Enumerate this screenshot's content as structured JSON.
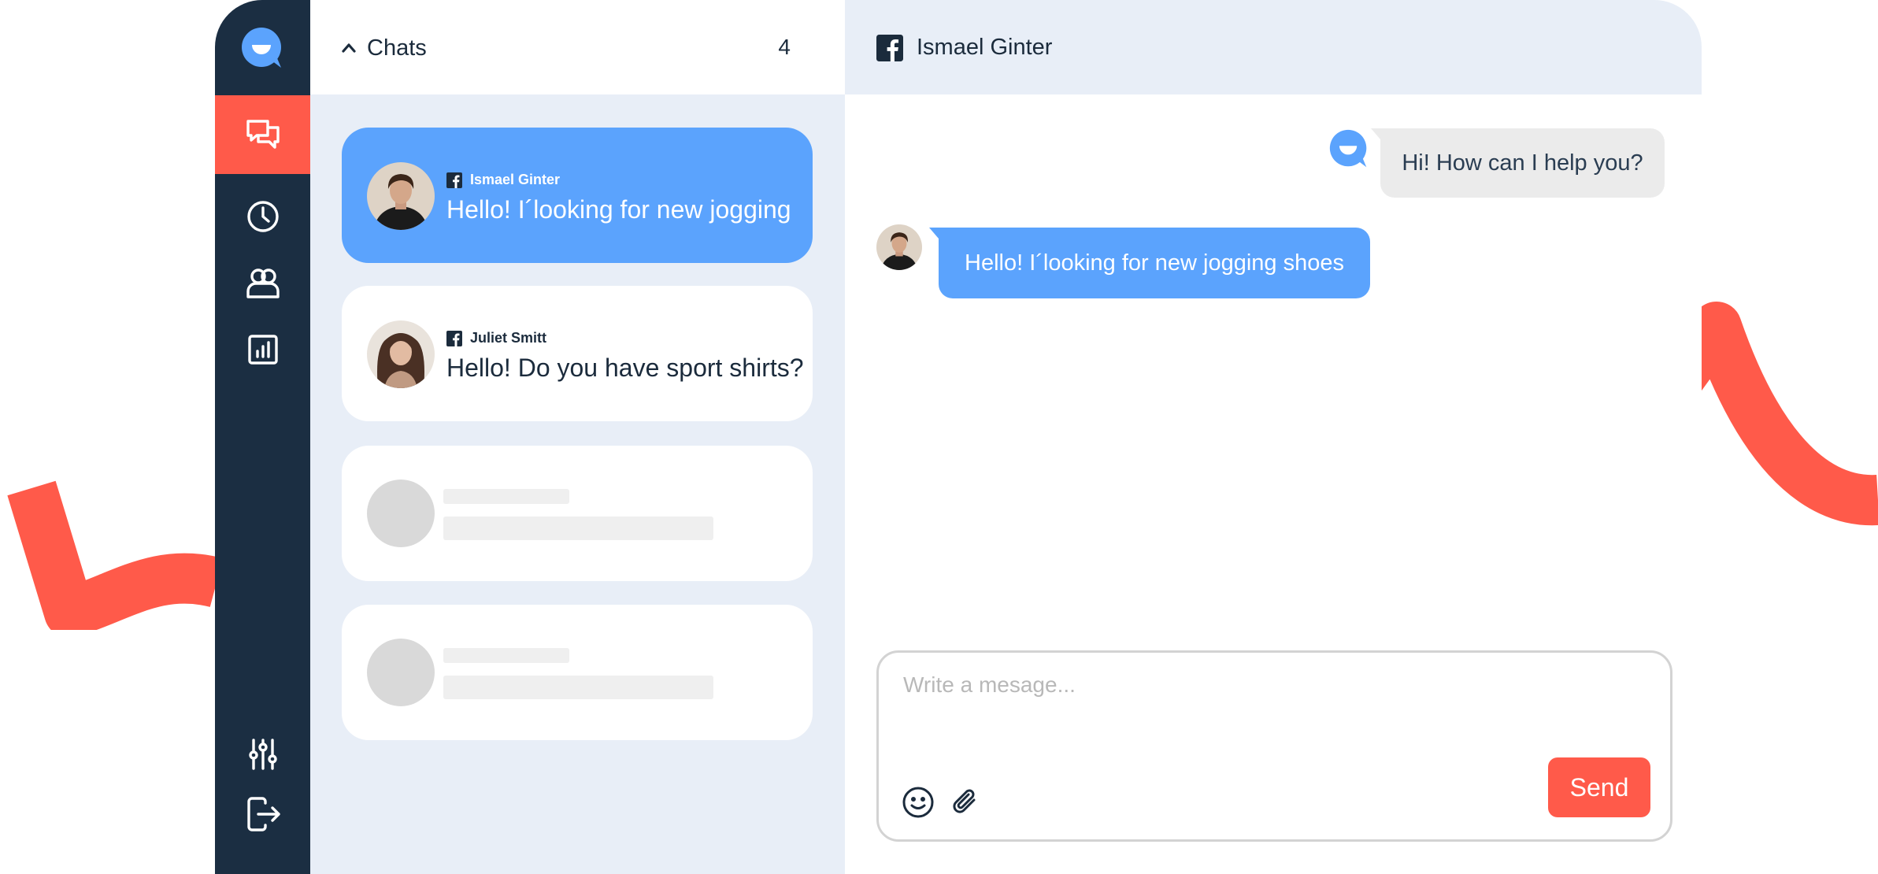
{
  "colors": {
    "rail_bg": "#1b2e42",
    "accent": "#ff5a4a",
    "primary_blue": "#5ba3fd",
    "panel_bg": "#e8eef7",
    "bubble_gray": "#ebebeb"
  },
  "sidebar": {
    "items": [
      {
        "icon": "chat-bubbles-icon",
        "active": true
      },
      {
        "icon": "clock-icon",
        "active": false
      },
      {
        "icon": "users-icon",
        "active": false
      },
      {
        "icon": "bar-chart-icon",
        "active": false
      }
    ],
    "bottom_items": [
      {
        "icon": "sliders-icon"
      },
      {
        "icon": "logout-icon"
      }
    ]
  },
  "chat_list": {
    "title": "Chats",
    "count": "4",
    "chats": [
      {
        "channel": "facebook",
        "name": "Ismael Ginter",
        "preview": "Hello! I´looking for new jogging",
        "active": true
      },
      {
        "channel": "facebook",
        "name": "Juliet Smitt",
        "preview": "Hello! Do you have sport shirts?",
        "active": false
      }
    ]
  },
  "conversation": {
    "channel": "facebook",
    "contact_name": "Ismael Ginter",
    "messages": [
      {
        "from": "agent",
        "text": "Hi! How can I help you?"
      },
      {
        "from": "customer",
        "text": "Hello! I´looking for new jogging shoes"
      }
    ]
  },
  "composer": {
    "placeholder": "Write a mesage...",
    "value": "",
    "send_label": "Send"
  }
}
